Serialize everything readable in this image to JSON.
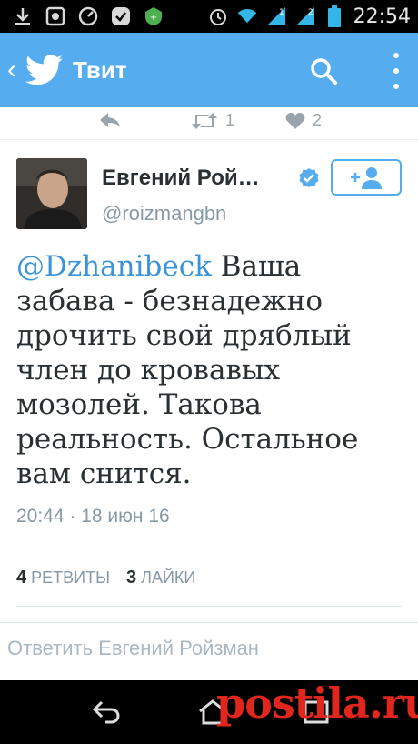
{
  "status_bar": {
    "time": "22:54",
    "icons": [
      "download-icon",
      "photo-icon",
      "speedometer-icon",
      "checkmark-badge-icon",
      "shield-icon",
      "alarm-icon",
      "wifi-icon",
      "signal-1-icon",
      "signal-2-icon",
      "battery-icon"
    ]
  },
  "app_bar": {
    "title": "Твит",
    "icons": [
      "back-chevron-icon",
      "twitter-bird-icon",
      "search-icon",
      "more-vert-icon"
    ],
    "color": "#55acee"
  },
  "previous_tweet_actions": {
    "retweets": "1",
    "likes": "2"
  },
  "tweet": {
    "author_name": "Евгений Рой…",
    "handle": "@roizmangbn",
    "mention": "@Dzhanibeck",
    "lines_first": "Ваша",
    "lines": [
      "забава - безнадежно",
      "дрочить свой дряблый",
      "член до кровавых",
      "мозолей. Такова",
      "реальность. Остальное",
      "вам снится."
    ],
    "timestamp": "20:44 · 18 июн 16",
    "retweet_count": "4",
    "retweet_label": "РЕТВИТЫ",
    "like_count": "3",
    "like_label": "ЛАЙКИ"
  },
  "reply": {
    "placeholder": "Ответить Евгений Ройзман"
  },
  "watermark": "postila.ru",
  "colors": {
    "accent": "#55acee",
    "mention": "#3b94d9",
    "text": "#292f33",
    "muted": "#8899a6",
    "watermark": "#e0261d"
  }
}
